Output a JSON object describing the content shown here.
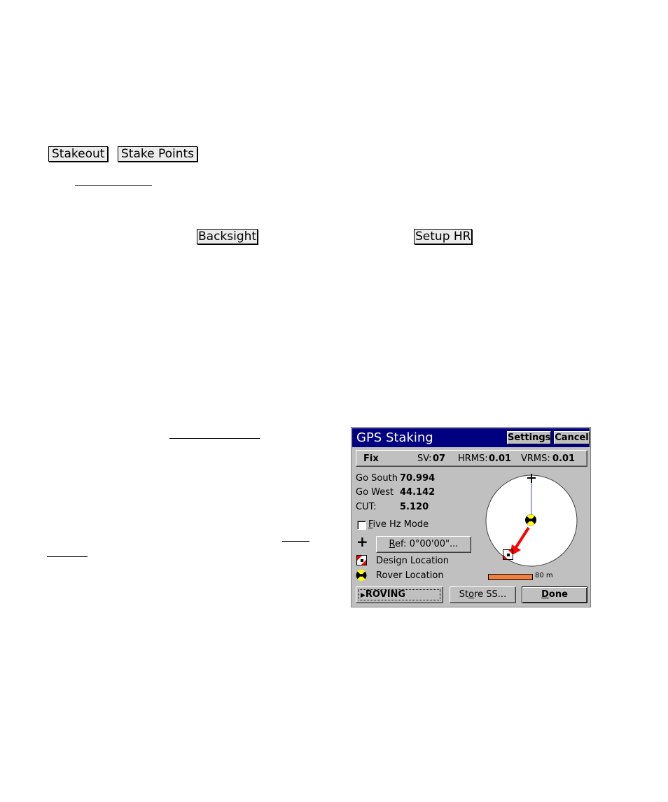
{
  "doc": {
    "key_buttons": {
      "stakeout": "Stakeout",
      "stake_points": "Stake Points",
      "backsight": "Backsight",
      "setup_hr": "Setup HR"
    }
  },
  "gps_staking": {
    "title": "GPS Staking",
    "settings_label": "Settings",
    "cancel_label": "Cancel",
    "status": {
      "solution": "Fix",
      "sv_label": "SV:",
      "sv_value": "07",
      "hrms_label": "HRMS:",
      "hrms_value": "0.01",
      "vrms_label": "VRMS:",
      "vrms_value": "0.01"
    },
    "readouts": [
      {
        "label": "Go South",
        "value": "70.994"
      },
      {
        "label": "Go West",
        "value": "44.142"
      },
      {
        "label": "CUT:",
        "value": "5.120"
      }
    ],
    "five_hz": {
      "label_hotkey": "F",
      "label_rest": "ive Hz Mode",
      "checked": false
    },
    "ref_button": {
      "hotkey": "R",
      "rest": "ef: 0°00'00\"..."
    },
    "legend": {
      "design": "Design Location",
      "rover": "Rover Location"
    },
    "scale_label": "80 m",
    "roving_label": "ROVING",
    "store_ss": {
      "pre": "St",
      "hotkey": "o",
      "post": "re SS..."
    },
    "done": {
      "hotkey": "D",
      "rest": "one"
    },
    "colors": {
      "titlebar": "#000080",
      "window": "#c0c0c0",
      "scale_bar": "#f08040",
      "arrow": "#ff0000",
      "north_line": "#6060ff"
    }
  }
}
